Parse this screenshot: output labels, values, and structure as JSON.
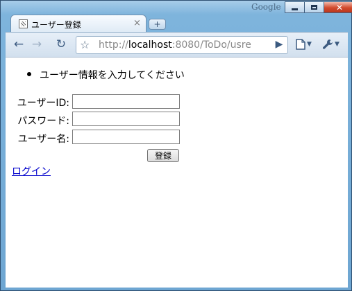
{
  "window": {
    "brand_label": "Google",
    "controls": {
      "minimize": "minimize",
      "maximize": "maximize",
      "close": "✕"
    }
  },
  "tab": {
    "title": "ユーザー登録",
    "close_glyph": "×",
    "new_tab_glyph": "+"
  },
  "toolbar": {
    "url_scheme": "http://",
    "url_host": "localhost",
    "url_rest": ":8080/ToDo/usre",
    "back_glyph": "←",
    "forward_glyph": "→",
    "reload_glyph": "↻",
    "star_glyph": "☆",
    "go_glyph": "▶"
  },
  "page": {
    "message": "ユーザー情報を入力してください",
    "form": {
      "user_id_label": "ユーザーID:",
      "user_id_value": "",
      "password_label": "パスワード:",
      "password_value": "",
      "user_name_label": "ユーザー名:",
      "user_name_value": "",
      "submit_label": "登録"
    },
    "login_link": "ログイン"
  },
  "colors": {
    "frame": "#7eb4dc",
    "link": "#0000cc",
    "close_button": "#d24a2c"
  }
}
